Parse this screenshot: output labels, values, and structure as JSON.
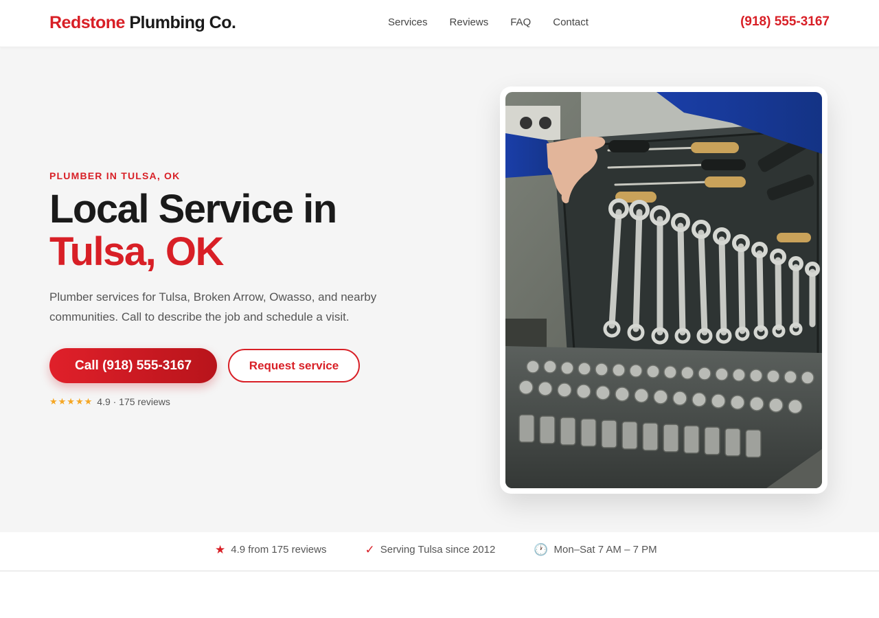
{
  "header": {
    "brand_first": "Redstone",
    "brand_second": "Plumbing Co.",
    "nav": [
      {
        "label": "Services"
      },
      {
        "label": "Reviews"
      },
      {
        "label": "FAQ"
      },
      {
        "label": "Contact"
      }
    ],
    "phone": "(918) 555-3167"
  },
  "hero": {
    "eyebrow": "PLUMBER IN TULSA, OK",
    "headline_line1": "Local Service in",
    "headline_line2": "Tulsa, OK",
    "lede": "Plumber services for Tulsa, Broken Arrow, Owasso, and nearby communities. Call to describe the job and schedule a visit.",
    "call_button": "Call (918) 555-3167",
    "request_button": "Request service",
    "stars": "★★★★★",
    "rating_text": "4.9 · 175 reviews",
    "photo_icon": "toolbox-photo"
  },
  "trust": [
    {
      "icon": "star-icon",
      "glyph": "★",
      "text": "4.9 from 175 reviews"
    },
    {
      "icon": "check-icon",
      "glyph": "✓",
      "text": "Serving Tulsa since 2012"
    },
    {
      "icon": "clock-icon",
      "glyph": "🕐",
      "text": "Mon–Sat 7 AM – 7 PM"
    }
  ],
  "colors": {
    "brand_red": "#d81f26",
    "star_gold": "#f5a623",
    "hero_bg": "#f5f5f5",
    "text_dark": "#1a1a1a"
  }
}
